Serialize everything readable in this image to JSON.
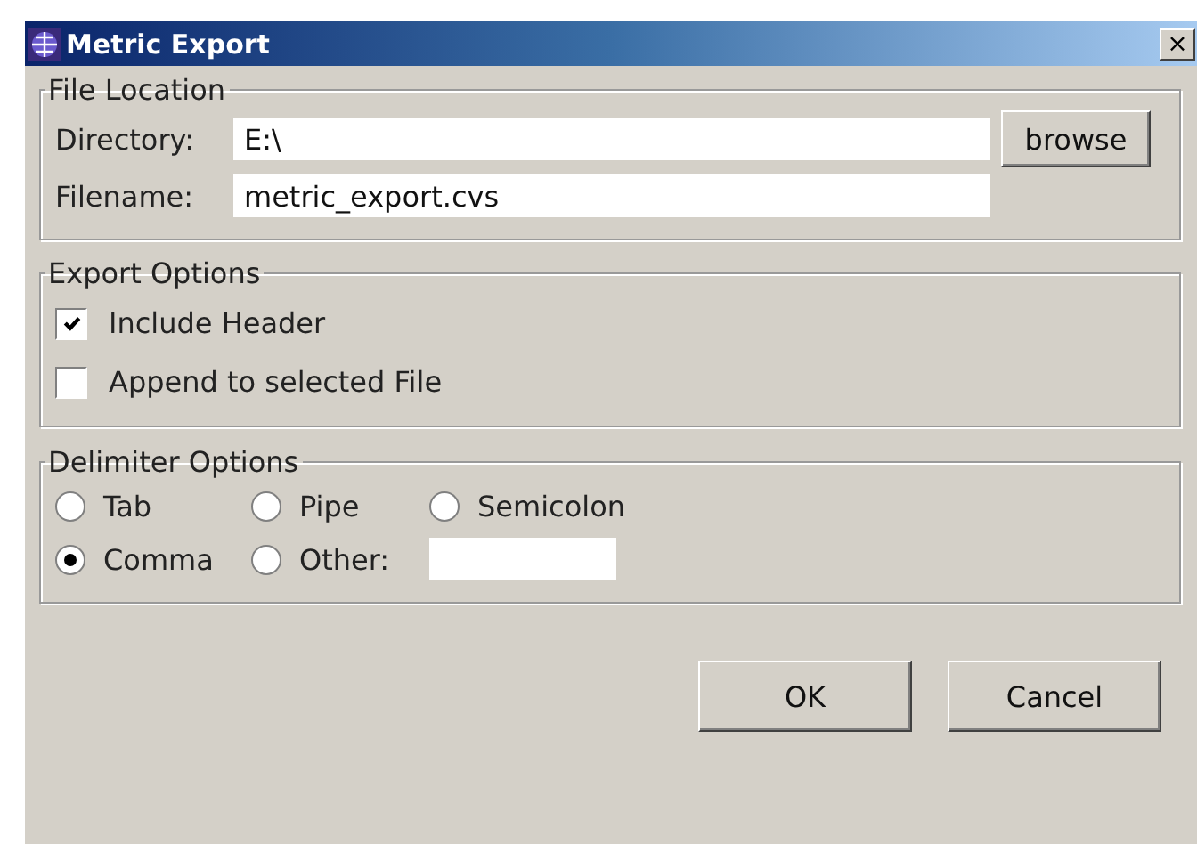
{
  "window": {
    "title": "Metric Export",
    "close": "×"
  },
  "file_location": {
    "legend": "File Location",
    "directory": {
      "label": "Directory:",
      "value": "E:\\"
    },
    "browse": "browse",
    "filename": {
      "label": "Filename:",
      "value": "metric_export.cvs"
    }
  },
  "export_options": {
    "legend": "Export Options",
    "items": [
      {
        "label": "Include Header",
        "checked": true
      },
      {
        "label": "Append to selected File",
        "checked": false
      }
    ]
  },
  "delimiter_options": {
    "legend": "Delimiter Options",
    "items": [
      {
        "label": "Tab",
        "selected": false
      },
      {
        "label": "Pipe",
        "selected": false
      },
      {
        "label": "Semicolon",
        "selected": false
      },
      {
        "label": "Comma",
        "selected": true
      },
      {
        "label": "Other:",
        "selected": false
      }
    ]
  },
  "buttons": [
    "OK",
    "Cancel"
  ]
}
